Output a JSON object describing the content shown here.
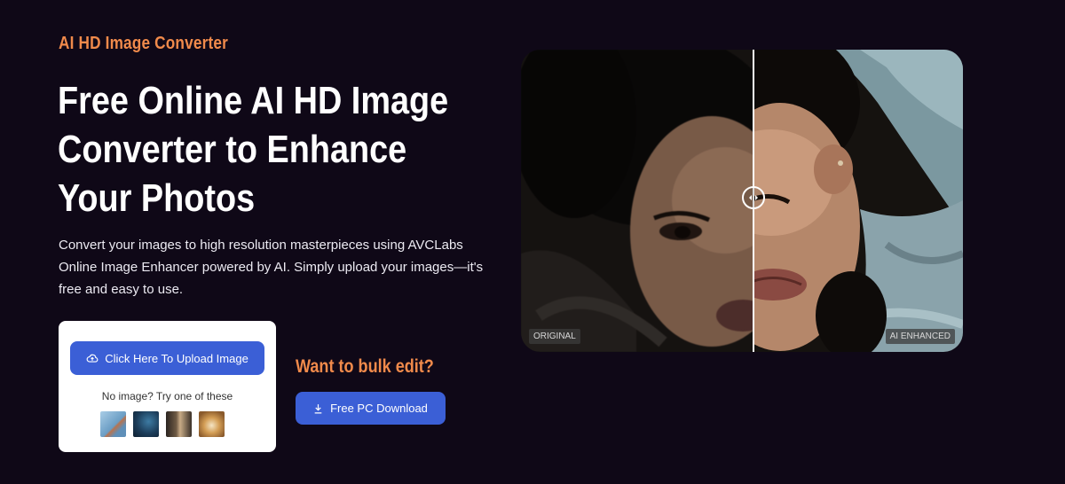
{
  "hero": {
    "eyebrow": "AI HD Image Converter",
    "headline": "Free Online AI HD Image Converter to Enhance Your Photos",
    "description": "Convert your images to high resolution masterpieces using AVCLabs Online Image Enhancer powered by AI. Simply upload your images—it's free and easy to use."
  },
  "upload_card": {
    "upload_label": "Click Here To Upload Image",
    "upload_icon": "cloud-upload-icon",
    "try_text": "No image? Try one of these",
    "samples": [
      "sample-bird",
      "sample-ocean",
      "sample-portrait",
      "sample-food"
    ]
  },
  "bulk": {
    "title": "Want to bulk edit?",
    "button_label": "Free PC Download",
    "button_icon": "download-icon"
  },
  "comparison": {
    "left_label": "ORIGINAL",
    "right_label": "AI ENHANCED"
  },
  "colors": {
    "background": "#0f0817",
    "accent_orange": "#f08a4b",
    "button_blue": "#3b5fd6"
  }
}
